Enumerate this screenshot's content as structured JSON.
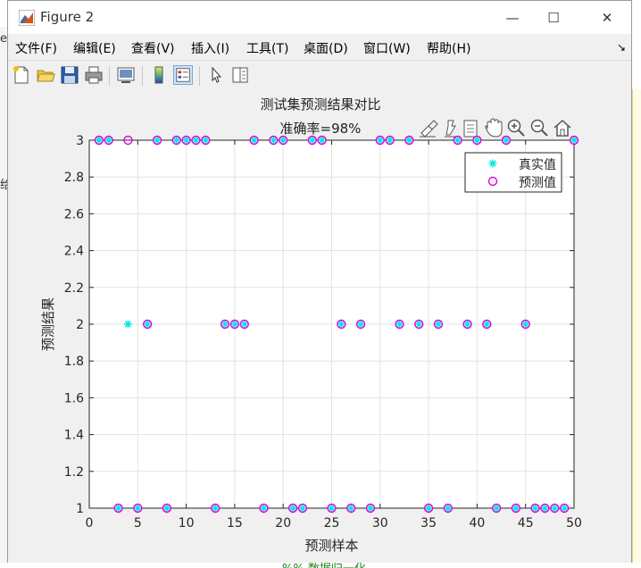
{
  "window": {
    "title": "Figure 2",
    "minimize_glyph": "—",
    "maximize_glyph": "☐",
    "close_glyph": "✕"
  },
  "menu": [
    "文件(F)",
    "编辑(E)",
    "查看(V)",
    "插入(I)",
    "工具(T)",
    "桌面(D)",
    "窗口(W)",
    "帮助(H)"
  ],
  "menu_more": "↘",
  "toolbar_icons": [
    "new-figure-icon",
    "open-file-icon",
    "save-icon",
    "print-icon",
    "link-icon",
    "colorbar-icon",
    "legend-icon",
    "pointer-icon",
    "property-inspector-icon"
  ],
  "axes_toolbar_icons": [
    "brush-icon",
    "data-tips-icon",
    "rotate-icon",
    "pan-icon",
    "zoom-in-icon",
    "zoom-out-icon",
    "home-icon"
  ],
  "background_fragments": {
    "left_top": "er",
    "left_mid": "给",
    "bottom": "%% 数据归一化"
  },
  "chart_data": {
    "type": "scatter",
    "title": "测试集预测结果对比",
    "subtitle": "准确率=98%",
    "xlabel": "预测样本",
    "ylabel": "预测结果",
    "xlim": [
      0,
      50
    ],
    "ylim": [
      1,
      3
    ],
    "xticks": [
      0,
      5,
      10,
      15,
      20,
      25,
      30,
      35,
      40,
      45,
      50
    ],
    "yticks": [
      1,
      1.2,
      1.4,
      1.6,
      1.8,
      2,
      2.2,
      2.4,
      2.6,
      2.8,
      3
    ],
    "grid": true,
    "legend_position": "top-right",
    "series": [
      {
        "name": "真实值",
        "marker": "asterisk",
        "color": "#00e5e5",
        "x": [
          1,
          2,
          3,
          4,
          5,
          6,
          7,
          8,
          9,
          10,
          11,
          12,
          13,
          14,
          15,
          16,
          17,
          18,
          19,
          20,
          21,
          22,
          23,
          24,
          25,
          26,
          27,
          28,
          29,
          30,
          31,
          32,
          33,
          34,
          35,
          36,
          37,
          38,
          39,
          40,
          41,
          42,
          43,
          44,
          45,
          46,
          47,
          48,
          49,
          50
        ],
        "y": [
          3,
          3,
          1,
          2,
          1,
          2,
          3,
          1,
          3,
          3,
          3,
          3,
          1,
          2,
          2,
          2,
          3,
          1,
          3,
          3,
          1,
          1,
          3,
          3,
          1,
          2,
          1,
          2,
          1,
          3,
          3,
          2,
          3,
          2,
          1,
          2,
          1,
          3,
          2,
          3,
          2,
          1,
          3,
          1,
          2,
          1,
          1,
          1,
          1,
          3
        ]
      },
      {
        "name": "预测值",
        "marker": "circle",
        "color": "#e000e0",
        "x": [
          1,
          2,
          3,
          4,
          5,
          6,
          7,
          8,
          9,
          10,
          11,
          12,
          13,
          14,
          15,
          16,
          17,
          18,
          19,
          20,
          21,
          22,
          23,
          24,
          25,
          26,
          27,
          28,
          29,
          30,
          31,
          32,
          33,
          34,
          35,
          36,
          37,
          38,
          39,
          40,
          41,
          42,
          43,
          44,
          45,
          46,
          47,
          48,
          49,
          50
        ],
        "y": [
          3,
          3,
          1,
          3,
          1,
          2,
          3,
          1,
          3,
          3,
          3,
          3,
          1,
          2,
          2,
          2,
          3,
          1,
          3,
          3,
          1,
          1,
          3,
          3,
          1,
          2,
          1,
          2,
          1,
          3,
          3,
          2,
          3,
          2,
          1,
          2,
          1,
          3,
          2,
          3,
          2,
          1,
          3,
          1,
          2,
          1,
          1,
          1,
          1,
          3
        ]
      }
    ]
  }
}
